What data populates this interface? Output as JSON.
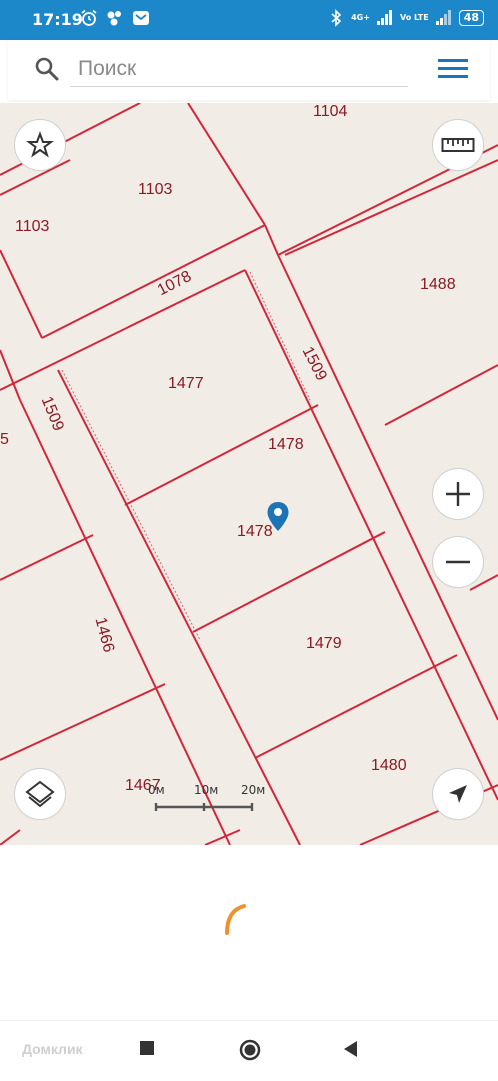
{
  "status_bar": {
    "time": "17:19",
    "network_tag_top": "4G+",
    "network_tag_bottom": "Vo LTE",
    "battery": "48"
  },
  "search": {
    "placeholder": "Поиск"
  },
  "map": {
    "parcels": [
      "1104",
      "1103",
      "1103",
      "1078",
      "1488",
      "1509",
      "1477",
      "1509",
      "1478",
      "1478",
      "1466",
      "1479",
      "1480",
      "1467",
      "5"
    ],
    "scale": {
      "labels": [
        "0м",
        "10м",
        "20м"
      ]
    }
  },
  "navigation": {
    "watermark": "Домклик"
  },
  "colors": {
    "status_bar": "#1d88c9",
    "accent": "#1d74b5",
    "parcel_lines": "#d3263a",
    "map_bg": "#f1ede6",
    "spinner": "#f0912a"
  }
}
